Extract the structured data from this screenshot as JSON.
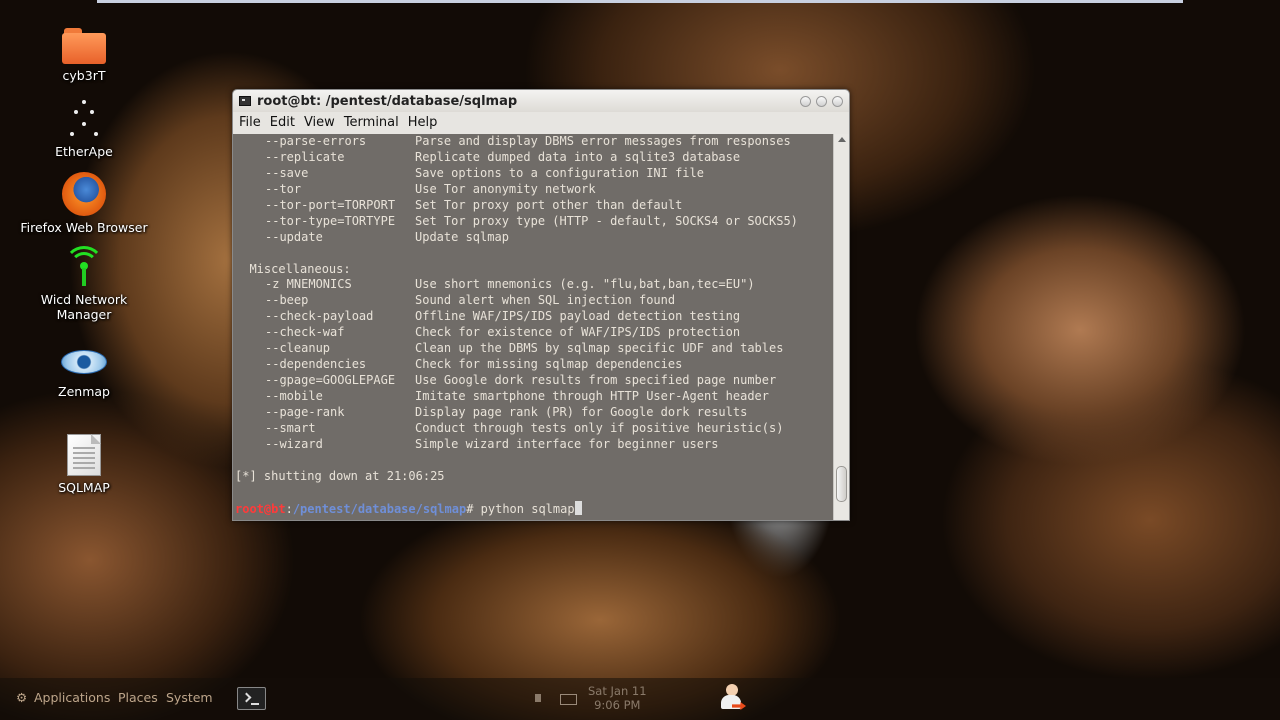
{
  "desktop": {
    "icons": [
      {
        "label": "cyb3rT",
        "icon": "folder-icon"
      },
      {
        "label": "EtherApe",
        "icon": "etherape-icon"
      },
      {
        "label": "Firefox Web Browser",
        "icon": "firefox-icon"
      },
      {
        "label": "Wicd Network Manager",
        "icon": "wicd-network-icon"
      },
      {
        "label": "Zenmap",
        "icon": "zenmap-eye-icon"
      },
      {
        "label": "SQLMAP",
        "icon": "text-document-icon"
      }
    ]
  },
  "window": {
    "title": "root@bt: /pentest/database/sqlmap",
    "menu": [
      "File",
      "Edit",
      "View",
      "Terminal",
      "Help"
    ]
  },
  "terminal": {
    "lines": [
      {
        "opt": "--parse-errors",
        "desc": "Parse and display DBMS error messages from responses"
      },
      {
        "opt": "--replicate",
        "desc": "Replicate dumped data into a sqlite3 database"
      },
      {
        "opt": "--save",
        "desc": "Save options to a configuration INI file"
      },
      {
        "opt": "--tor",
        "desc": "Use Tor anonymity network"
      },
      {
        "opt": "--tor-port=TORPORT",
        "desc": "Set Tor proxy port other than default"
      },
      {
        "opt": "--tor-type=TORTYPE",
        "desc": "Set Tor proxy type (HTTP - default, SOCKS4 or SOCKS5)"
      },
      {
        "opt": "--update",
        "desc": "Update sqlmap"
      },
      {
        "text": ""
      },
      {
        "text": "  Miscellaneous:"
      },
      {
        "opt": "-z MNEMONICS",
        "desc": "Use short mnemonics (e.g. \"flu,bat,ban,tec=EU\")"
      },
      {
        "opt": "--beep",
        "desc": "Sound alert when SQL injection found"
      },
      {
        "opt": "--check-payload",
        "desc": "Offline WAF/IPS/IDS payload detection testing"
      },
      {
        "opt": "--check-waf",
        "desc": "Check for existence of WAF/IPS/IDS protection"
      },
      {
        "opt": "--cleanup",
        "desc": "Clean up the DBMS by sqlmap specific UDF and tables"
      },
      {
        "opt": "--dependencies",
        "desc": "Check for missing sqlmap dependencies"
      },
      {
        "opt": "--gpage=GOOGLEPAGE",
        "desc": "Use Google dork results from specified page number"
      },
      {
        "opt": "--mobile",
        "desc": "Imitate smartphone through HTTP User-Agent header"
      },
      {
        "opt": "--page-rank",
        "desc": "Display page rank (PR) for Google dork results"
      },
      {
        "opt": "--smart",
        "desc": "Conduct through tests only if positive heuristic(s)"
      },
      {
        "opt": "--wizard",
        "desc": "Simple wizard interface for beginner users"
      },
      {
        "text": ""
      },
      {
        "text": "[*] shutting down at 21:06:25"
      },
      {
        "text": ""
      }
    ],
    "prompt": {
      "user": "root@bt",
      "sep": ":",
      "path": "/pentest/database/sqlmap",
      "symbol": "# ",
      "command": "python sqlmap"
    }
  },
  "panel": {
    "menus": [
      "Applications",
      "Places",
      "System"
    ],
    "clock_date": "Sat Jan 11",
    "clock_time": "9:06 PM"
  }
}
